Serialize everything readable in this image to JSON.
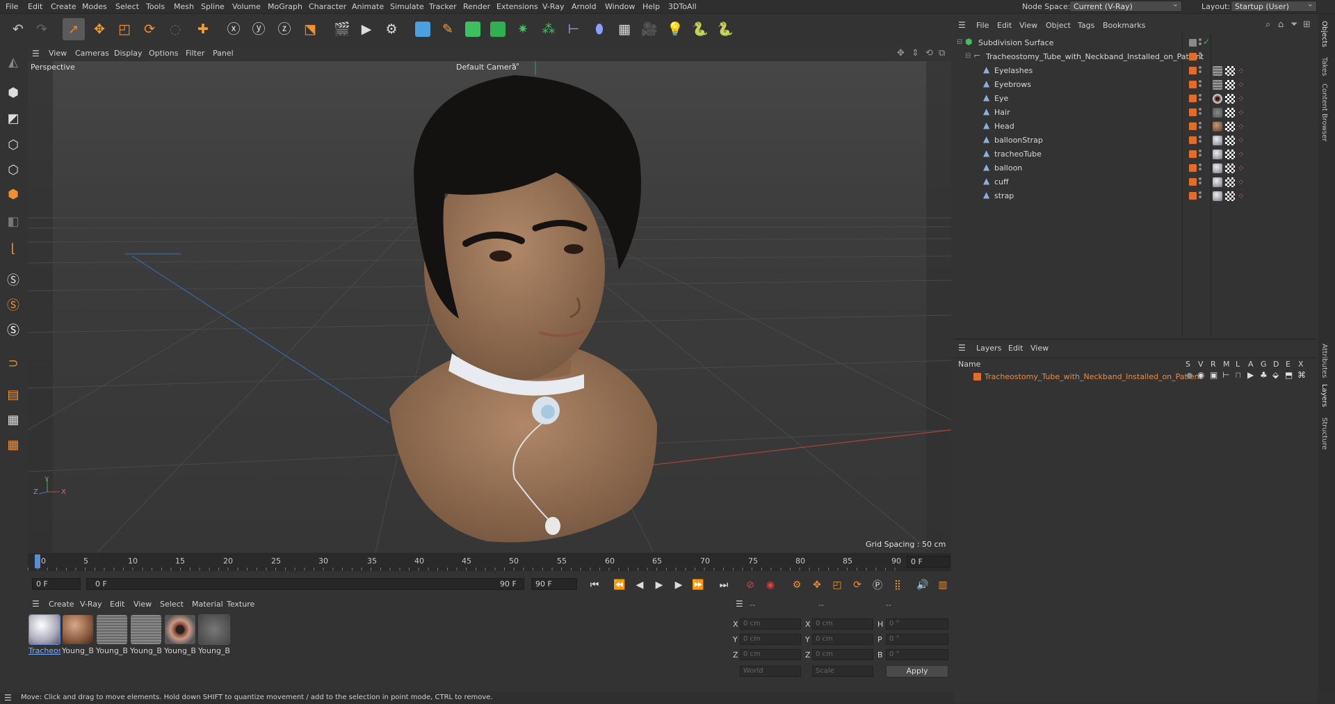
{
  "menubar": {
    "items": [
      "File",
      "Edit",
      "Create",
      "Modes",
      "Select",
      "Tools",
      "Mesh",
      "Spline",
      "Volume",
      "MoGraph",
      "Character",
      "Animate",
      "Simulate",
      "Tracker",
      "Render",
      "Extensions",
      "V-Ray",
      "Arnold",
      "Window",
      "Help",
      "3DToAll"
    ],
    "node_space_label": "Node Space:",
    "node_space_value": "Current (V-Ray)",
    "layout_label": "Layout:",
    "layout_value": "Startup (User)"
  },
  "viewport": {
    "menu": [
      "View",
      "Cameras",
      "Display",
      "Options",
      "Filter",
      "Panel"
    ],
    "view_name": "Perspective",
    "camera": "Default Camera",
    "camera_suffix": "°°",
    "grid_spacing": "Grid Spacing : 50 cm",
    "axis_labels": {
      "y": "Y",
      "z": "Z",
      "x": "X"
    }
  },
  "timeline": {
    "ticks": [
      "0",
      "5",
      "10",
      "15",
      "20",
      "25",
      "30",
      "35",
      "40",
      "45",
      "50",
      "55",
      "60",
      "65",
      "70",
      "75",
      "80",
      "85",
      "90"
    ],
    "current_frame": "0 F",
    "start_field": "0 F",
    "range_start": "0 F",
    "range_end": "90 F",
    "end_field": "90 F"
  },
  "material_manager": {
    "menu": [
      "Create",
      "V-Ray",
      "Edit",
      "View",
      "Select",
      "Material",
      "Texture"
    ],
    "materials": [
      {
        "label": "Tracheos",
        "selected": true
      },
      {
        "label": "Young_B",
        "selected": false
      },
      {
        "label": "Young_B",
        "selected": false
      },
      {
        "label": "Young_B",
        "selected": false
      },
      {
        "label": "Young_B",
        "selected": false
      },
      {
        "label": "Young_B",
        "selected": false
      }
    ]
  },
  "coordinates": {
    "headers": [
      "--",
      "--",
      "--"
    ],
    "rows": [
      {
        "a": "X",
        "av": "0 cm",
        "b": "X",
        "bv": "0 cm",
        "c": "H",
        "cv": "0 °"
      },
      {
        "a": "Y",
        "av": "0 cm",
        "b": "Y",
        "bv": "0 cm",
        "c": "P",
        "cv": "0 °"
      },
      {
        "a": "Z",
        "av": "0 cm",
        "b": "Z",
        "bv": "0 cm",
        "c": "B",
        "cv": "0 °"
      }
    ],
    "world": "World",
    "scale": "Scale",
    "apply": "Apply"
  },
  "object_manager": {
    "menu": [
      "File",
      "Edit",
      "View",
      "Object",
      "Tags",
      "Bookmarks"
    ],
    "root": "Subdivision Surface",
    "group": "Tracheostomy_Tube_with_Neckband_Installed_on_Patient",
    "children": [
      "Eyelashes",
      "Eyebrows",
      "Eye",
      "Hair",
      "Head",
      "balloonStrap",
      "tracheoTube",
      "balloon",
      "cuff",
      "strap"
    ]
  },
  "layers": {
    "menu": [
      "Layers",
      "Edit",
      "View"
    ],
    "name_header": "Name",
    "flags": [
      "S",
      "V",
      "R",
      "M",
      "L",
      "A",
      "G",
      "D",
      "E",
      "X"
    ],
    "layer_name": "Tracheostomy_Tube_with_Neckband_Installed_on_Patient"
  },
  "right_tabs": [
    "Objects",
    "Takes",
    "Content Browser",
    "Attributes",
    "Layers",
    "Structure"
  ],
  "status": "Move: Click and drag to move elements. Hold down SHIFT to quantize movement / add to the selection in point mode, CTRL to remove.",
  "colors": {
    "accent_orange": "#e06d2a",
    "selected_blue": "#5b8cd8",
    "background": "#333333"
  }
}
